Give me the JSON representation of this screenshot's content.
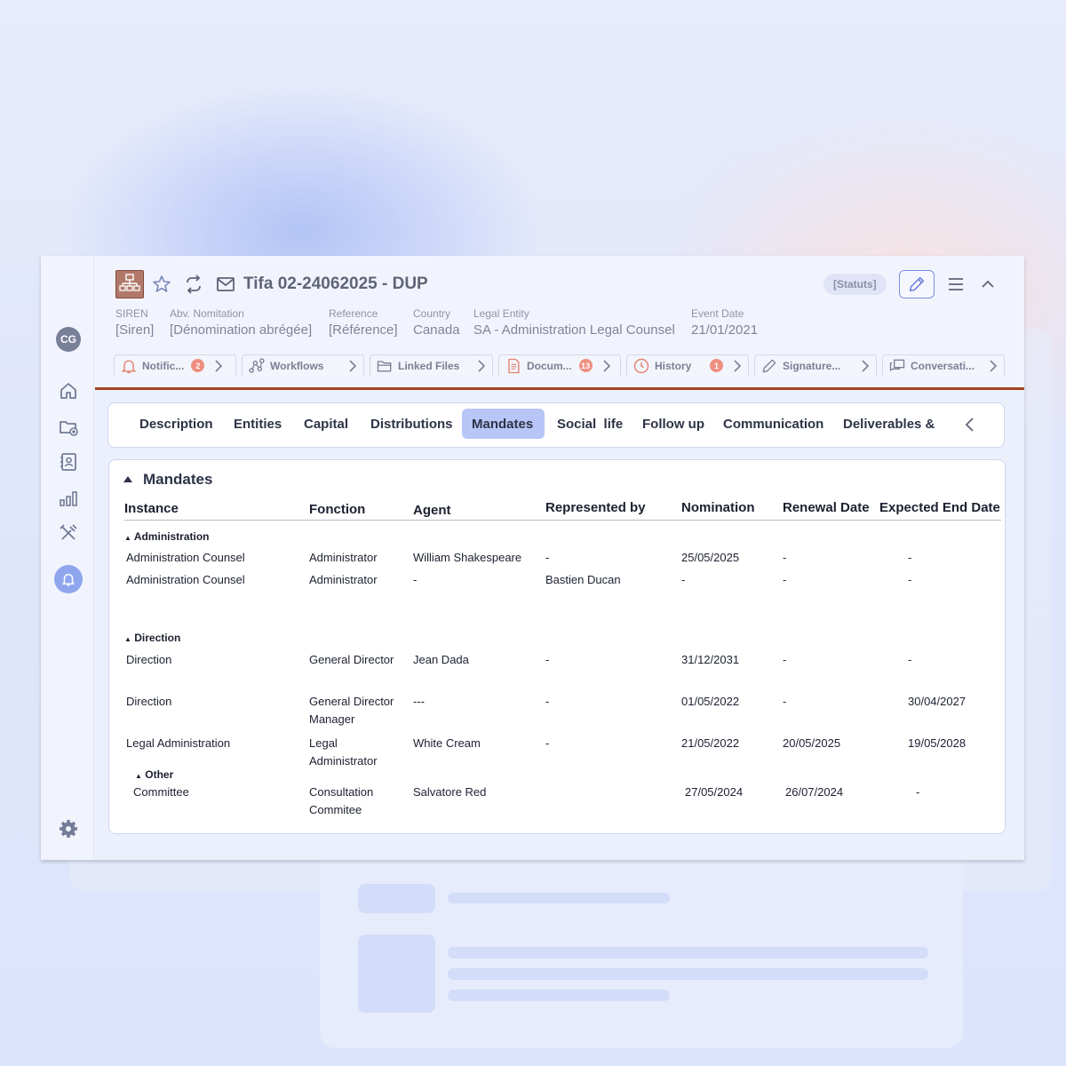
{
  "sidebar": {
    "avatar_initials": "CG"
  },
  "header": {
    "title": "Tifa 02-24062025 - DUP",
    "status_badge": "[Statuts]",
    "meta": [
      {
        "label": "SIREN",
        "value": "[Siren]"
      },
      {
        "label": "Abv. Nomitation",
        "value": "[Dénomination abrégée]"
      },
      {
        "label": "Reference",
        "value": "[Référence]"
      },
      {
        "label": "Country",
        "value": "Canada"
      },
      {
        "label": "Legal Entity",
        "value": "SA - Administration Legal Counsel"
      },
      {
        "label": "Event Date",
        "value": "21/01/2021"
      }
    ],
    "chips": [
      {
        "label": "Notific...",
        "badge": "2",
        "icon": "bell-icon"
      },
      {
        "label": "Workflows",
        "badge": "",
        "icon": "workflow-icon"
      },
      {
        "label": "Linked Files",
        "badge": "",
        "icon": "folder-icon"
      },
      {
        "label": "Docum...",
        "badge": "13",
        "icon": "document-icon"
      },
      {
        "label": "History",
        "badge": "1",
        "icon": "clock-icon"
      },
      {
        "label": "Signature...",
        "badge": "",
        "icon": "pen-icon"
      },
      {
        "label": "Conversati...",
        "badge": "",
        "icon": "chat-icon"
      }
    ]
  },
  "tabs": [
    "Description",
    "Entities",
    "Capital",
    "Distributions",
    "Mandates",
    "Social  life",
    "Follow up",
    "Communication",
    "Deliverables &"
  ],
  "active_tab": "Mandates",
  "mandates": {
    "section_title": "Mandates",
    "columns": [
      "Instance",
      "Fonction",
      "Agent",
      "Represented by",
      "Nomination",
      "Renewal Date",
      "Expected End Date"
    ],
    "groups": {
      "administration": "Administration",
      "direction": "Direction",
      "other": "Other"
    },
    "rows": {
      "r1": {
        "instance": "Administration Counsel",
        "fonction": "Administrator",
        "agent": "William Shakespeare",
        "represented": "-",
        "nomination": "25/05/2025",
        "renewal": "-",
        "end": "-"
      },
      "r2": {
        "instance": "Administration Counsel",
        "fonction": "Administrator",
        "agent": "-",
        "represented": "Bastien Ducan",
        "nomination": "-",
        "renewal": "-",
        "end": "-"
      },
      "r3": {
        "instance": "Direction",
        "fonction": "General Director",
        "agent": "Jean Dada",
        "represented": "-",
        "nomination": "31/12/2031",
        "renewal": "-",
        "end": "-"
      },
      "r4": {
        "instance": "Direction",
        "fonction_1": "General Director",
        "fonction_2": "Manager",
        "agent": "---",
        "represented": "-",
        "nomination": "01/05/2022",
        "renewal": "-",
        "end": "30/04/2027"
      },
      "r5": {
        "instance": "Legal Administration",
        "fonction_1": "Legal",
        "fonction_2": "Administrator",
        "agent": "White Cream",
        "represented": "-",
        "nomination": "21/05/2022",
        "renewal": "20/05/2025",
        "end": "19/05/2028"
      },
      "r6": {
        "instance": "Committee",
        "fonction_1": "Consultation",
        "fonction_2": "Commitee",
        "agent": "Salvatore Red",
        "nomination": "27/05/2024",
        "renewal": "26/07/2024",
        "end": "-"
      }
    }
  }
}
